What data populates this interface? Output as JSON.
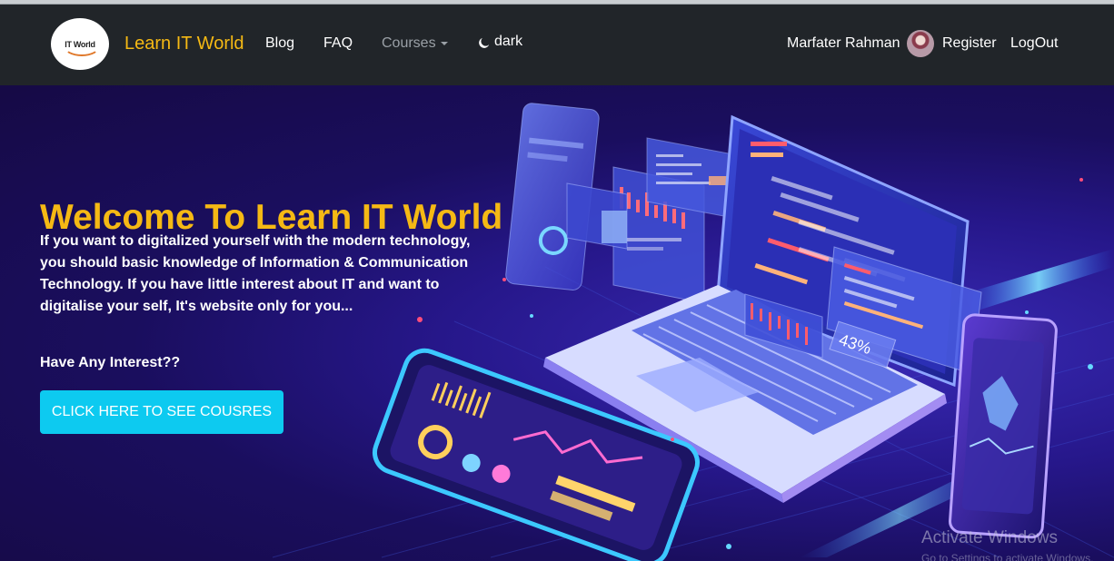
{
  "navbar": {
    "logo_text": "IT World",
    "brand": "Learn IT World",
    "links": [
      "Blog",
      "FAQ"
    ],
    "courses_label": "Courses",
    "theme_toggle_label": "dark",
    "user_name": "Marfater Rahman",
    "register_label": "Register",
    "logout_label": "LogOut"
  },
  "hero": {
    "title": "Welcome To Learn IT World",
    "description": "If you want to digitalized yourself with the modern technology, you should basic knowledge of Information & Communication Technology. If you have little interest about IT and want to digitalise your self, It's website only for you...",
    "question": "Have Any Interest??",
    "cta_label": "CLICK HERE TO SEE COUSRES",
    "illustration_badge": "43%"
  },
  "watermark": {
    "line1": "Activate Windows",
    "line2": "Go to Settings to activate Windows."
  },
  "colors": {
    "navbar_bg": "#212529",
    "brand": "#f5b914",
    "cta_bg": "#0dcaf0",
    "hero_bg": "#1a0e5e"
  }
}
